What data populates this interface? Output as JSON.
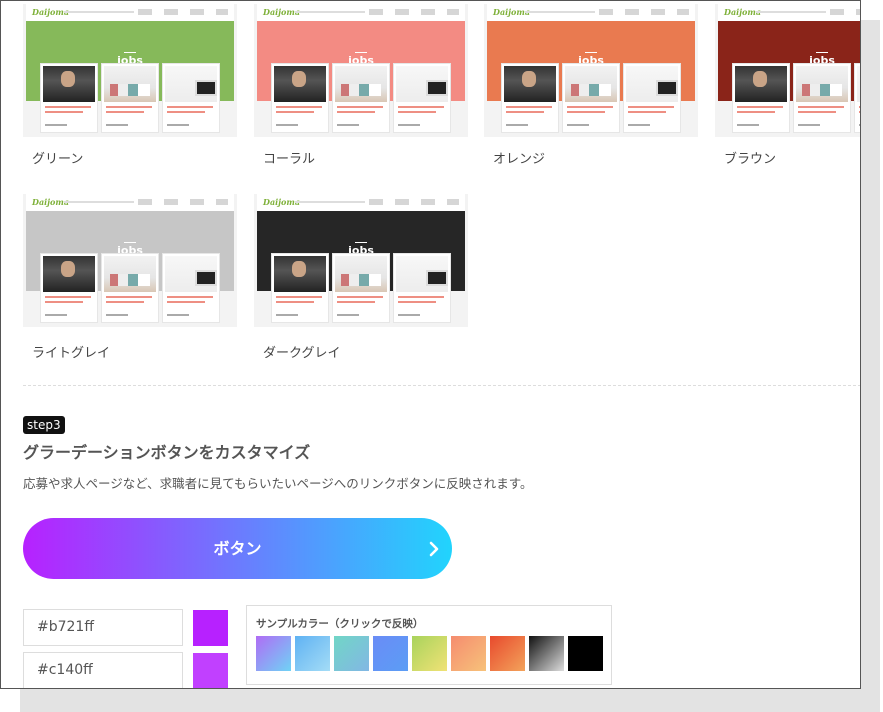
{
  "themes": [
    {
      "name": "グリーン",
      "color": "#86b95a"
    },
    {
      "name": "コーラル",
      "color": "#f38b83"
    },
    {
      "name": "オレンジ",
      "color": "#e97a50"
    },
    {
      "name": "ブラウン",
      "color": "#8a2419"
    },
    {
      "name": "ライトグレイ",
      "color": "#c6c6c6"
    },
    {
      "name": "ダークグレイ",
      "color": "#262626"
    }
  ],
  "thumbnail": {
    "logo": "Daijoma",
    "banner_title": "jobs"
  },
  "step": {
    "badge": "step3",
    "title": "グラーデーションボタンをカスタマイズ",
    "description": "応募や求人ページなど、求職者に見てもらいたいページへのリンクボタンに反映されます。"
  },
  "preview_button": {
    "label": "ボタン",
    "gradient_start": "#b721ff",
    "gradient_end": "#21d4fd"
  },
  "color_inputs": [
    {
      "value": "#b721ff",
      "swatch": "#b721ff"
    },
    {
      "value": "#c140ff",
      "swatch": "#c140ff"
    }
  ],
  "sample_colors": {
    "title": "サンプルカラー（クリックで反映）",
    "swatches": [
      {
        "from": "#b06cf5",
        "to": "#6fd3f5"
      },
      {
        "from": "#5fb2f3",
        "to": "#a4dcf6"
      },
      {
        "from": "#71d6c6",
        "to": "#82b7e4"
      },
      {
        "from": "#6a8cf6",
        "to": "#5b9df5"
      },
      {
        "from": "#a9d35c",
        "to": "#f0e276"
      },
      {
        "from": "#f58c6f",
        "to": "#f7c27a"
      },
      {
        "from": "#e84a2d",
        "to": "#f3a35b"
      },
      {
        "from": "#111111",
        "to": "#dddddd"
      },
      {
        "from": "#000000",
        "to": "#000000"
      }
    ]
  }
}
